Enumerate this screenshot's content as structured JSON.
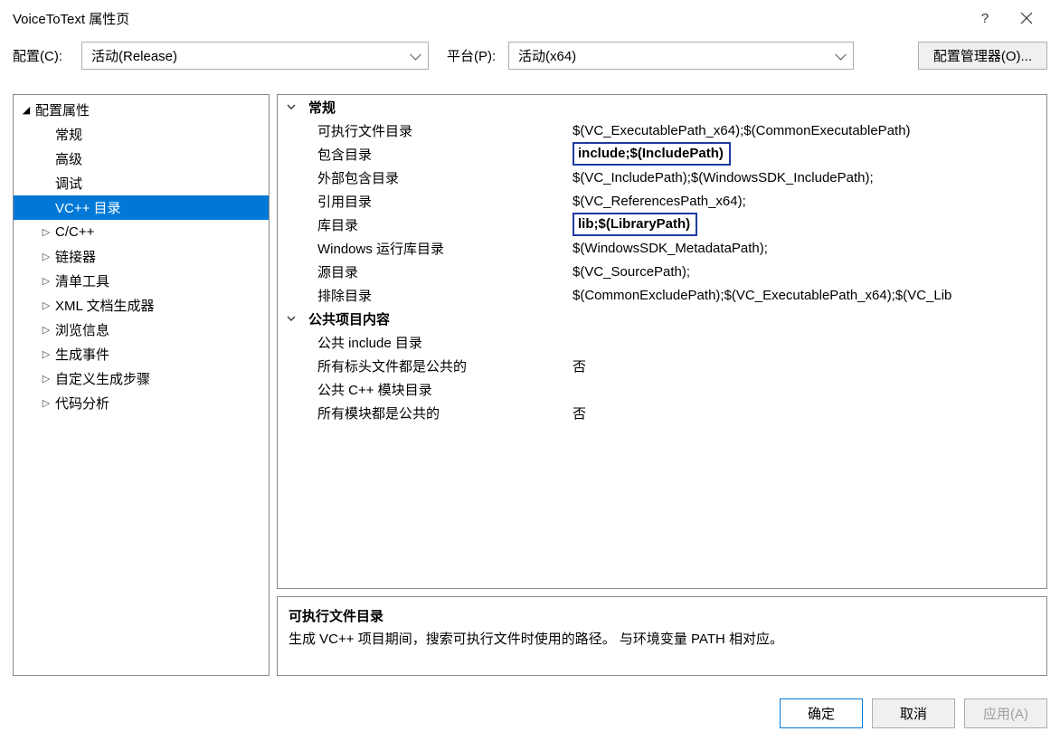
{
  "window": {
    "title": "VoiceToText 属性页"
  },
  "toolbar": {
    "config_label": "配置(C):",
    "config_value": "活动(Release)",
    "platform_label": "平台(P):",
    "platform_value": "活动(x64)",
    "config_manager": "配置管理器(O)..."
  },
  "tree": {
    "root": "配置属性",
    "items": [
      "常规",
      "高级",
      "调试",
      "VC++ 目录",
      "C/C++",
      "链接器",
      "清单工具",
      "XML 文档生成器",
      "浏览信息",
      "生成事件",
      "自定义生成步骤",
      "代码分析"
    ],
    "selected_index": 3,
    "expandable_indices": [
      4,
      5,
      6,
      7,
      8,
      9,
      10,
      11
    ]
  },
  "grid": {
    "groups": [
      {
        "label": "常规",
        "rows": [
          {
            "key": "可执行文件目录",
            "value": "$(VC_ExecutablePath_x64);$(CommonExecutablePath)",
            "boxed": false
          },
          {
            "key": "包含目录",
            "value": "include;$(IncludePath)",
            "boxed": true
          },
          {
            "key": "外部包含目录",
            "value": "$(VC_IncludePath);$(WindowsSDK_IncludePath);",
            "boxed": false
          },
          {
            "key": "引用目录",
            "value": "$(VC_ReferencesPath_x64);",
            "boxed": false
          },
          {
            "key": "库目录",
            "value": "lib;$(LibraryPath)",
            "boxed": true
          },
          {
            "key": "Windows 运行库目录",
            "value": "$(WindowsSDK_MetadataPath);",
            "boxed": false
          },
          {
            "key": "源目录",
            "value": "$(VC_SourcePath);",
            "boxed": false
          },
          {
            "key": "排除目录",
            "value": "$(CommonExcludePath);$(VC_ExecutablePath_x64);$(VC_Lib",
            "boxed": false
          }
        ]
      },
      {
        "label": "公共项目内容",
        "rows": [
          {
            "key": "公共 include 目录",
            "value": "",
            "boxed": false
          },
          {
            "key": "所有标头文件都是公共的",
            "value": "否",
            "boxed": false
          },
          {
            "key": "公共 C++ 模块目录",
            "value": "",
            "boxed": false
          },
          {
            "key": "所有模块都是公共的",
            "value": "否",
            "boxed": false
          }
        ]
      }
    ]
  },
  "description": {
    "title": "可执行文件目录",
    "body": "生成 VC++ 项目期间，搜索可执行文件时使用的路径。 与环境变量 PATH 相对应。"
  },
  "buttons": {
    "ok": "确定",
    "cancel": "取消",
    "apply": "应用(A)"
  }
}
